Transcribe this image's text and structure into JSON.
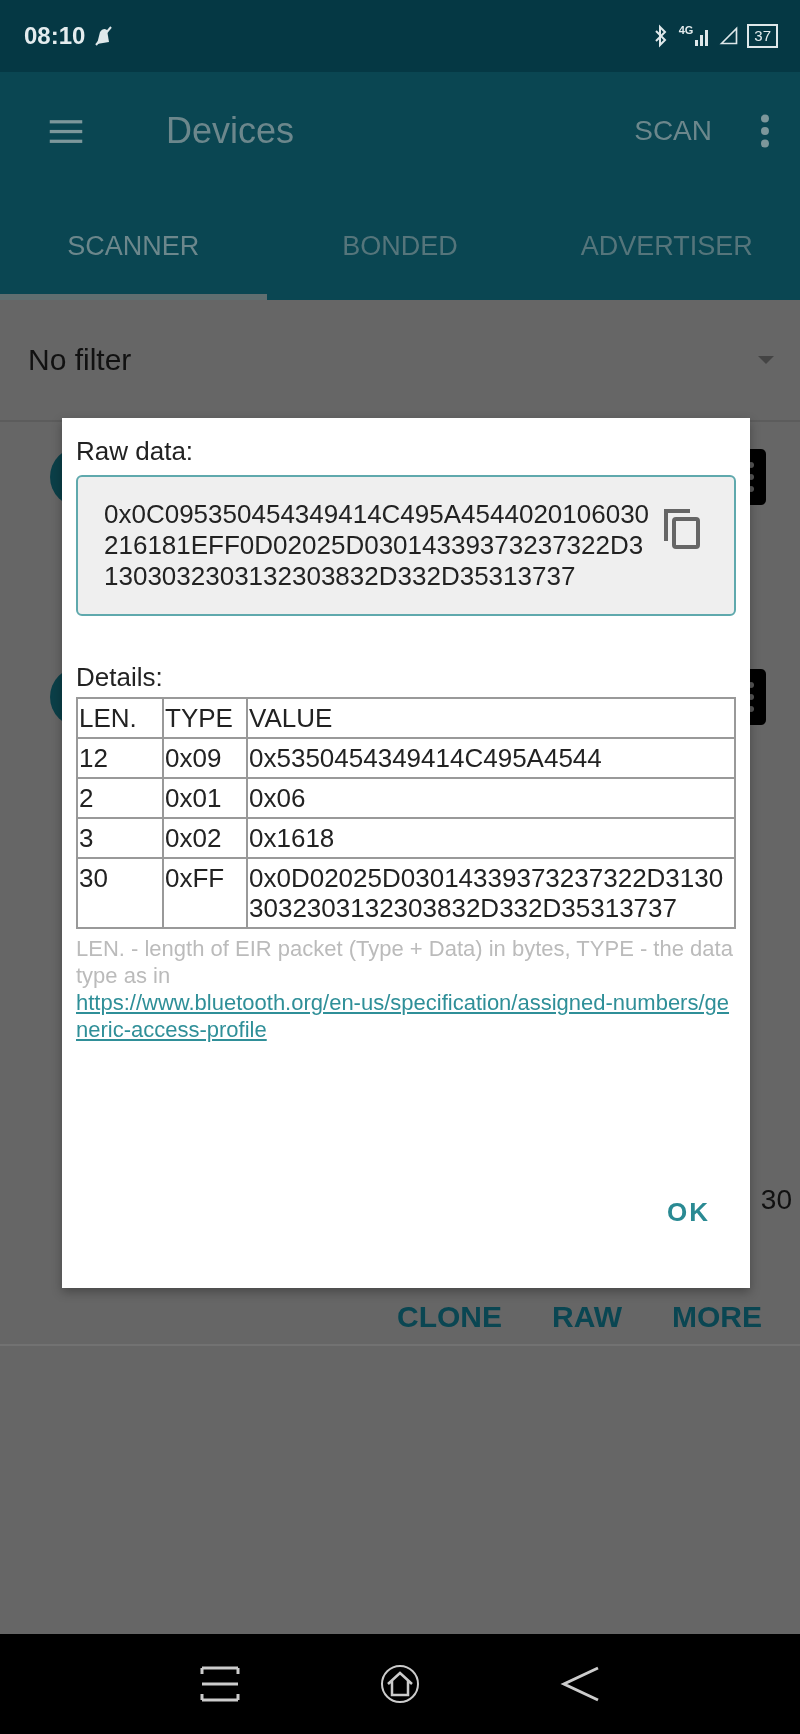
{
  "status_bar": {
    "time": "08:10",
    "network": "4G",
    "battery": "37"
  },
  "app_bar": {
    "title": "Devices",
    "action": "SCAN"
  },
  "tabs": [
    {
      "label": "SCANNER",
      "selected": true
    },
    {
      "label": "BONDED",
      "selected": false
    },
    {
      "label": "ADVERTISER",
      "selected": false
    }
  ],
  "filter": {
    "value": "No filter"
  },
  "device_card": {
    "reading": "30",
    "actions": [
      "CLONE",
      "RAW",
      "MORE"
    ]
  },
  "dialog": {
    "raw_data_label": "Raw data:",
    "raw_data": "0x0C095350454349414C495A4544020106030216181EFF0D02025D03014339373237322D31303032303132303832D332D35313737",
    "details_label": "Details:",
    "columns": [
      "LEN.",
      "TYPE",
      "VALUE"
    ],
    "rows": [
      {
        "len": "12",
        "type": "0x09",
        "value": "0x5350454349414C495A4544"
      },
      {
        "len": "2",
        "type": "0x01",
        "value": "0x06"
      },
      {
        "len": "3",
        "type": "0x02",
        "value": "0x1618"
      },
      {
        "len": "30",
        "type": "0xFF",
        "value": "0x0D02025D03014339373237322D31303032303132303832D332D35313737"
      }
    ],
    "note": "LEN. - length of EIR packet (Type + Data) in bytes, TYPE - the data type as in ",
    "link": "https://www.bluetooth.org/en-us/specification/assigned-numbers/generic-access-profile",
    "button": "OK"
  }
}
